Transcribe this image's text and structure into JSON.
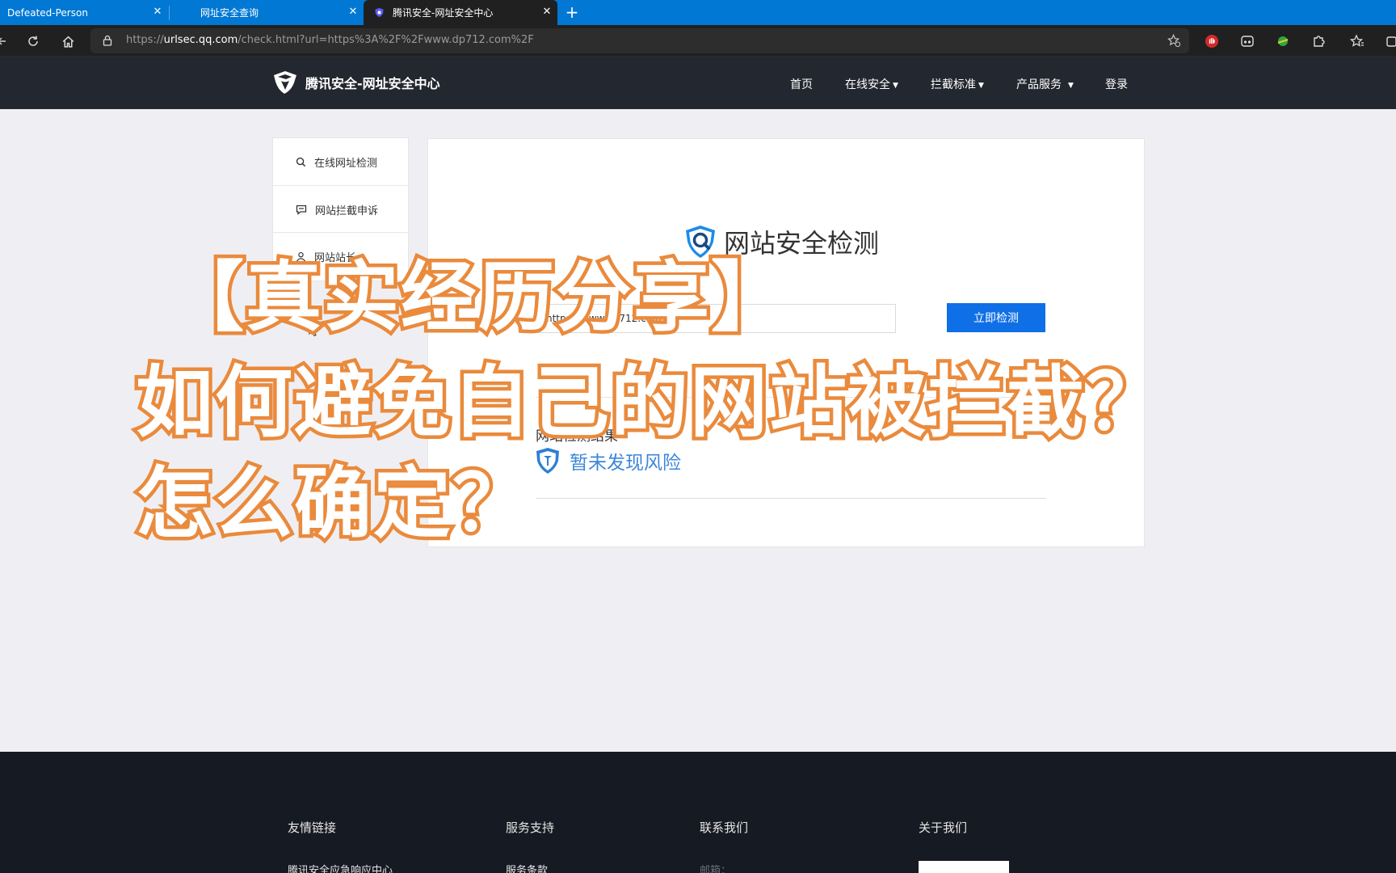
{
  "browser": {
    "tabs": [
      {
        "label": "Defeated-Person",
        "active": false
      },
      {
        "label": "网址安全查询",
        "active": false
      },
      {
        "label": "腾讯安全-网址安全中心",
        "active": true
      }
    ],
    "address": {
      "prefix": "https://",
      "host": "urlsec.qq.com",
      "path": "/check.html?url=https%3A%2F%2Fwww.dp712.com%2F"
    }
  },
  "site": {
    "logo_text": "腾讯安全-网址安全中心",
    "nav": [
      {
        "label": "首页",
        "dropdown": false
      },
      {
        "label": "在线安全",
        "dropdown": true
      },
      {
        "label": "拦截标准",
        "dropdown": true
      },
      {
        "label": "产品服务",
        "dropdown": true
      },
      {
        "label": "登录",
        "dropdown": false
      }
    ]
  },
  "sidebar": {
    "items": [
      {
        "label": "在线网址检测",
        "icon": "search-icon"
      },
      {
        "label": "网站拦截申诉",
        "icon": "comment-icon"
      },
      {
        "label": "网站站长",
        "icon": "user-icon"
      }
    ]
  },
  "main": {
    "title": "网站安全检测",
    "url_input_value": "https://www.dp712.com",
    "check_button": "立即检测",
    "result_label": "网站检测结果",
    "result_text": "暂未发现风险",
    "accent_color": "#0f6fe6",
    "result_color": "#3d86d8"
  },
  "footer": {
    "columns": [
      {
        "title": "友情链接",
        "first_link": "腾讯安全应急响应中心"
      },
      {
        "title": "服务支持",
        "first_link": "服务条款"
      },
      {
        "title": "联系我们",
        "first_link": "邮箱："
      },
      {
        "title": "关于我们",
        "first_link": ""
      }
    ]
  },
  "overlay": {
    "line1": "【真实经历分享】",
    "line2": "如何避免自己的网站被拦截？",
    "line3": "怎么确定？",
    "stroke_color": "#ea8a3c"
  }
}
